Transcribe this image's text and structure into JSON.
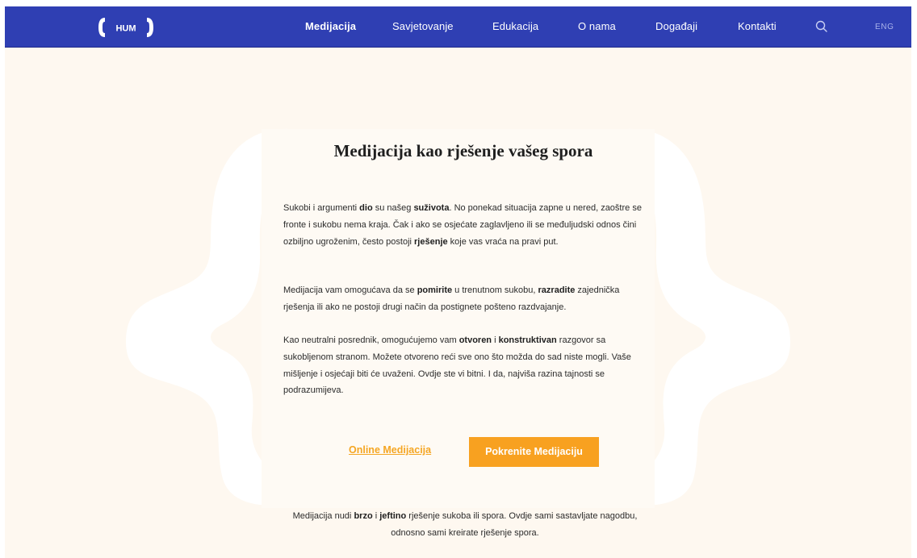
{
  "colors": {
    "nav_background": "#2f3fb3",
    "page_background": "#fef8f0",
    "accent": "#f8a120",
    "bracket_shape": "#ffffff"
  },
  "nav": {
    "logo_text": "HUM",
    "items": [
      {
        "label": "Medijacija",
        "active": true
      },
      {
        "label": "Savjetovanje",
        "active": false
      },
      {
        "label": "Edukacija",
        "active": false
      },
      {
        "label": "O nama",
        "active": false
      },
      {
        "label": "Događaji",
        "active": false
      },
      {
        "label": "Kontakti",
        "active": false
      }
    ],
    "search_icon": "search-icon",
    "language": "ENG"
  },
  "main": {
    "title": "Medijacija kao rješenje vašeg spora",
    "p1": {
      "t1": "Sukobi i argumenti ",
      "b1": "dio",
      "t2": " su našeg ",
      "b2": "suživota",
      "t3": ". No ponekad situacija zapne u nered, zaoštre se fronte i sukobu nema kraja. Čak i ako se osjećate zaglavljeno ili se međuljudski odnos čini ozbiljno ugroženim, često postoji ",
      "b3": "rješenje",
      "t4": " koje vas vraća na pravi put."
    },
    "p2": {
      "t1": "Medijacija vam omogućava da se ",
      "b1": "pomirite",
      "t2": " u trenutnom sukobu, ",
      "b2": "razradite",
      "t3": " zajednička rješenja ili ako ne postoji drugi način da postignete pošteno razdvajanje."
    },
    "p3": {
      "t1": "Kao neutralni posrednik, omogućujemo vam ",
      "b1": "otvoren",
      "t2": " i ",
      "b2": "konstruktivan",
      "t3": " razgovor sa sukobljenom stranom. Možete otvoreno reći sve ono što možda do sad niste mogli. Vaše mišljenje i osjećaji biti će uvaženi. Ovdje ste vi bitni. I da, najviša razina tajnosti se podrazumijeva."
    },
    "link_online": "Online Medijacija",
    "button_start": "Pokrenite Medijaciju",
    "footer": {
      "t1": "Medijacija nudi ",
      "b1": "brzo",
      "t2": " i ",
      "b2": "jeftino",
      "t3": " rješenje sukoba ili spora. Ovdje sami sastavljate nagodbu, odnosno sami kreirate rješenje spora."
    }
  }
}
